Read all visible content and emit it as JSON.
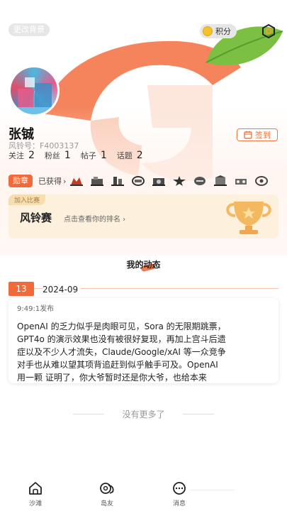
{
  "profile": {
    "change_background": "更改背景",
    "points_label": "积分",
    "name": "张铖",
    "fengling_id": "风铃号：F4003137",
    "checkin_label": "签到",
    "stats": [
      {
        "label": "关注",
        "value": "2"
      },
      {
        "label": "粉丝",
        "value": "1"
      },
      {
        "label": "帖子",
        "value": "1"
      },
      {
        "label": "话题",
        "value": "2"
      }
    ]
  },
  "medals": {
    "tag": "勋章",
    "obtained": "已获得",
    "arrow": "›",
    "icons": [
      "medal-1-icon",
      "medal-2-icon",
      "medal-3-icon",
      "medal-4-icon",
      "medal-5-icon",
      "medal-6-icon",
      "medal-7-icon",
      "medal-8-icon",
      "medal-9-icon",
      "medal-10-icon"
    ]
  },
  "contest": {
    "tag": "加入比赛",
    "title": "风铃赛",
    "subtitle": "点击查看你的排名 ›"
  },
  "feed": {
    "title": "我的动态",
    "date_day": "13",
    "date_month": "2024-09",
    "post": {
      "time": "9:49:1发布",
      "lines": [
        "OpenAI 的乏力似乎是肉眼可见，Sora 的无限期跳票，",
        "GPT4o 的演示效果也没有被很好复现，再加上宫斗后遗",
        "症以及不少人才流失，Claude/Google/xAI 等一众竞争",
        "对手也从难以望其项背追赶到似乎触手可及。OpenAI",
        "用一颗 证明了，你大爷暂时还是你大爷，也给本来"
      ]
    },
    "no_more": "没有更多了"
  },
  "tabs": [
    {
      "label": "沙滩"
    },
    {
      "label": "岛友"
    },
    {
      "label": "消息"
    }
  ],
  "colors": {
    "accent": "#f26a3a",
    "leaf": "#7bc043",
    "coin": "#f3c22c"
  }
}
